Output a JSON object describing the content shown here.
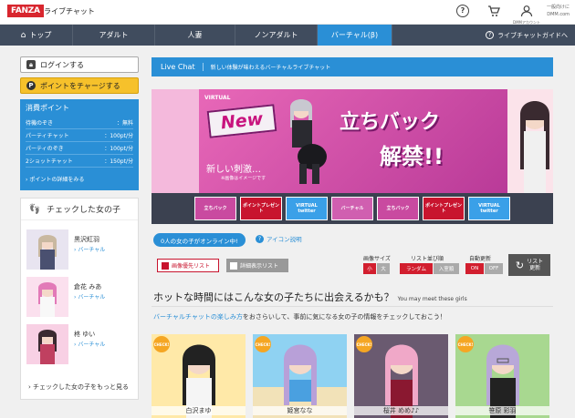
{
  "header": {
    "logo": "FANZA",
    "service": "ライブチャット",
    "account_label": "DMMアカウント",
    "right_line1": "一般向けに",
    "right_line2": "DMM.com"
  },
  "nav": {
    "items": [
      {
        "label": "トップ",
        "active": false
      },
      {
        "label": "アダルト",
        "active": false
      },
      {
        "label": "人妻",
        "active": false
      },
      {
        "label": "ノンアダルト",
        "active": false
      },
      {
        "label": "バーチャル(β)",
        "active": true
      }
    ],
    "guide": "ライブチャットガイドへ"
  },
  "sidebar": {
    "login": "ログインする",
    "charge": "ポイントをチャージする",
    "points": {
      "title": "消費ポイント",
      "rows": [
        {
          "label": "待機のぞき",
          "value": "：無料"
        },
        {
          "label": "パーティチャット",
          "value": "：100pt/分"
        },
        {
          "label": "パーティのぞき",
          "value": "：100pt/分"
        },
        {
          "label": "2ショットチャット",
          "value": "：150pt/分"
        }
      ],
      "more": "ポイントの詳細をみる"
    },
    "checked": {
      "title": "チェックした女の子",
      "girls": [
        {
          "name": "黒沢紅羽",
          "tag": "バーチャル"
        },
        {
          "name": "倉花 みあ",
          "tag": "バーチャル"
        },
        {
          "name": "柊 ゆい",
          "tag": "バーチャル"
        }
      ],
      "more": "チェックした女の子をもっと見る"
    }
  },
  "main": {
    "livechat_title": "Live Chat",
    "livechat_sub": "新しい体験が味わえるバーチャルライブチャット",
    "banner": {
      "virtual": "VIRTUAL",
      "new": "New",
      "headline1": "立ちバック",
      "headline2": "解禁!!",
      "sub": "新しい刺激…",
      "note": "※画像はイメージです"
    },
    "thumbs": [
      {
        "label": "立ちバック",
        "color": "#c94aa0"
      },
      {
        "label": "ポイントプレゼント",
        "color": "#c8142e"
      },
      {
        "label": "VIRTUAL twitter",
        "color": "#3aa0e8"
      },
      {
        "label": "バーチャル",
        "color": "#d05fb0"
      },
      {
        "label": "立ちバック",
        "color": "#c94aa0"
      },
      {
        "label": "ポイントプレゼント",
        "color": "#c8142e"
      },
      {
        "label": "VIRTUAL twitter",
        "color": "#3aa0e8"
      }
    ],
    "online": "0人の女の子がオンライン中!",
    "icon_explain": "アイコン説明",
    "view_image": "画像優先リスト",
    "view_detail": "詳細表示リスト",
    "controls": {
      "size_label": "画像サイズ",
      "size_small": "小",
      "size_large": "大",
      "order_label": "リスト並び順",
      "order_random": "ランダム",
      "order_entry": "入室順",
      "auto_label": "自動更新",
      "auto_on": "ON",
      "auto_off": "OFF",
      "refresh_line1": "リスト",
      "refresh_line2": "更新"
    },
    "heading": "ホットな時間にはこんな女の子たちに出会えるかも？",
    "heading_en": "You may meet these girls",
    "intro_link": "バーチャルチャットの楽しみ方",
    "intro_rest": "をおさらいして、事前に気になる女の子の情報をチェックしておこう！",
    "cards": [
      {
        "name": "白沢まゆ",
        "bg": "#ffe9a8",
        "badge": "CHECK!"
      },
      {
        "name": "姫宮なな",
        "bg": "#ffe9a8",
        "badge": "CHECK!"
      },
      {
        "name": "桜井 めめ♪♪",
        "bg": "#ffe9a8",
        "badge": "CHECK!"
      },
      {
        "name": "笹原 彩羽",
        "bg": "#ffe9a8",
        "badge": "CHECK!"
      }
    ]
  }
}
